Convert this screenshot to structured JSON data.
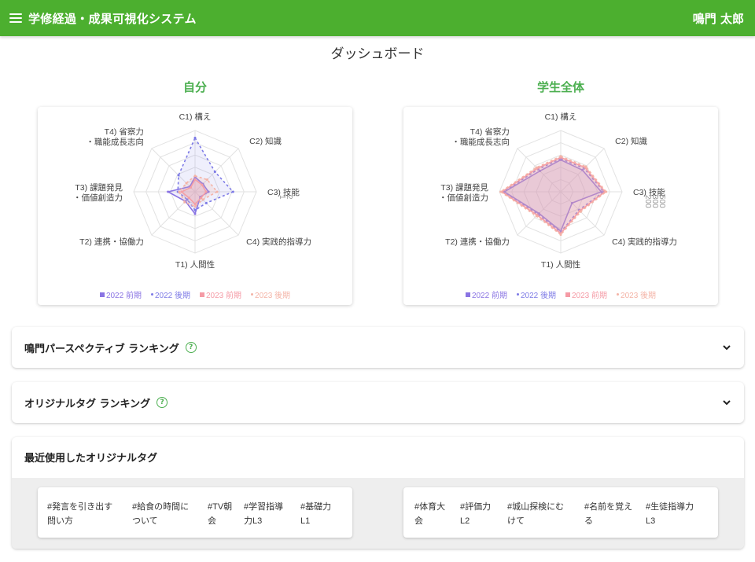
{
  "header": {
    "app_title": "学修経過・成果可視化システム",
    "user_name": "鳴門 太郎"
  },
  "page": {
    "title": "ダッシュボード"
  },
  "charts": {
    "self_heading": "自分",
    "all_heading": "学生全体"
  },
  "chart_data": [
    {
      "type": "radar",
      "title": "自分",
      "axes": [
        "C1) 構え",
        "C2) 知識",
        "C3) 技能",
        "C4) 実践的指導力",
        "T1) 人間性",
        "T2) 連携・協働力",
        "T3) 課題発見\n・価値創造力",
        "T4) 省察力\n・職能成長志向"
      ],
      "scale_labels": [
        "1",
        "2"
      ],
      "rmax": 5,
      "series": [
        {
          "name": "2022 前期",
          "values": [
            1.2,
            0.9,
            1.1,
            0.6,
            1.8,
            1.1,
            2.2,
            0.6
          ]
        },
        {
          "name": "2022 後期",
          "values": [
            4.4,
            2.3,
            3.1,
            1.3,
            1.5,
            0.9,
            1.4,
            1.9
          ]
        },
        {
          "name": "2023 前期",
          "values": [
            1.0,
            0.8,
            0.9,
            0.7,
            1.0,
            0.7,
            1.1,
            0.5
          ]
        },
        {
          "name": "2023 後期",
          "values": [
            1.3,
            1.4,
            1.8,
            0.9,
            1.2,
            1.2,
            1.3,
            1.0
          ]
        }
      ]
    },
    {
      "type": "radar",
      "title": "学生全体",
      "axes": [
        "C1) 構え",
        "C2) 知識",
        "C3) 技能",
        "C4) 実践的指導力",
        "T1) 人間性",
        "T2) 連携・協働力",
        "T3) 課題発見\n・価値創造力",
        "T4) 省察力\n・職能成長志向"
      ],
      "scale_labels": [
        "200",
        "300",
        "500"
      ],
      "rmax": 5,
      "series": [
        {
          "name": "2022 前期",
          "values": [
            2.6,
            2.5,
            3.3,
            1.3,
            3.2,
            2.5,
            4.6,
            2.4
          ]
        },
        {
          "name": "2022 後期",
          "values": [
            2.7,
            2.7,
            3.5,
            2.1,
            3.3,
            2.6,
            4.7,
            2.6
          ]
        },
        {
          "name": "2023 前期",
          "values": [
            2.8,
            2.8,
            3.6,
            2.2,
            3.4,
            2.7,
            4.8,
            2.7
          ]
        },
        {
          "name": "2023 後期",
          "values": [
            2.9,
            2.9,
            3.7,
            2.3,
            3.5,
            2.8,
            4.9,
            2.8
          ]
        }
      ]
    }
  ],
  "legend_colors": [
    "#8a74e3",
    "#7d7ae6",
    "#f59aa5",
    "#f4b3a6"
  ],
  "legend_labels": [
    "2022 前期",
    "2022 後期",
    "2023 前期",
    "2023 後期"
  ],
  "panels": {
    "perspective_ranking": "鳴門パースペクティブ ランキング",
    "tag_ranking": "オリジナルタグ ランキング",
    "help_glyph": "?"
  },
  "recent_tags": {
    "title": "最近使用したオリジナルタグ",
    "left": [
      "#発言を引き出す\n問い方",
      "#給食の時間に\nついて",
      "#TV朝\n会",
      "#学習指導\n力L3",
      "#基礎力\nL1"
    ],
    "right": [
      "#体育大\n会",
      "#評価力\nL2",
      "#城山探検にむ\nけて",
      "#名前を覚え\nる",
      "#生徒指導力\nL3"
    ]
  }
}
